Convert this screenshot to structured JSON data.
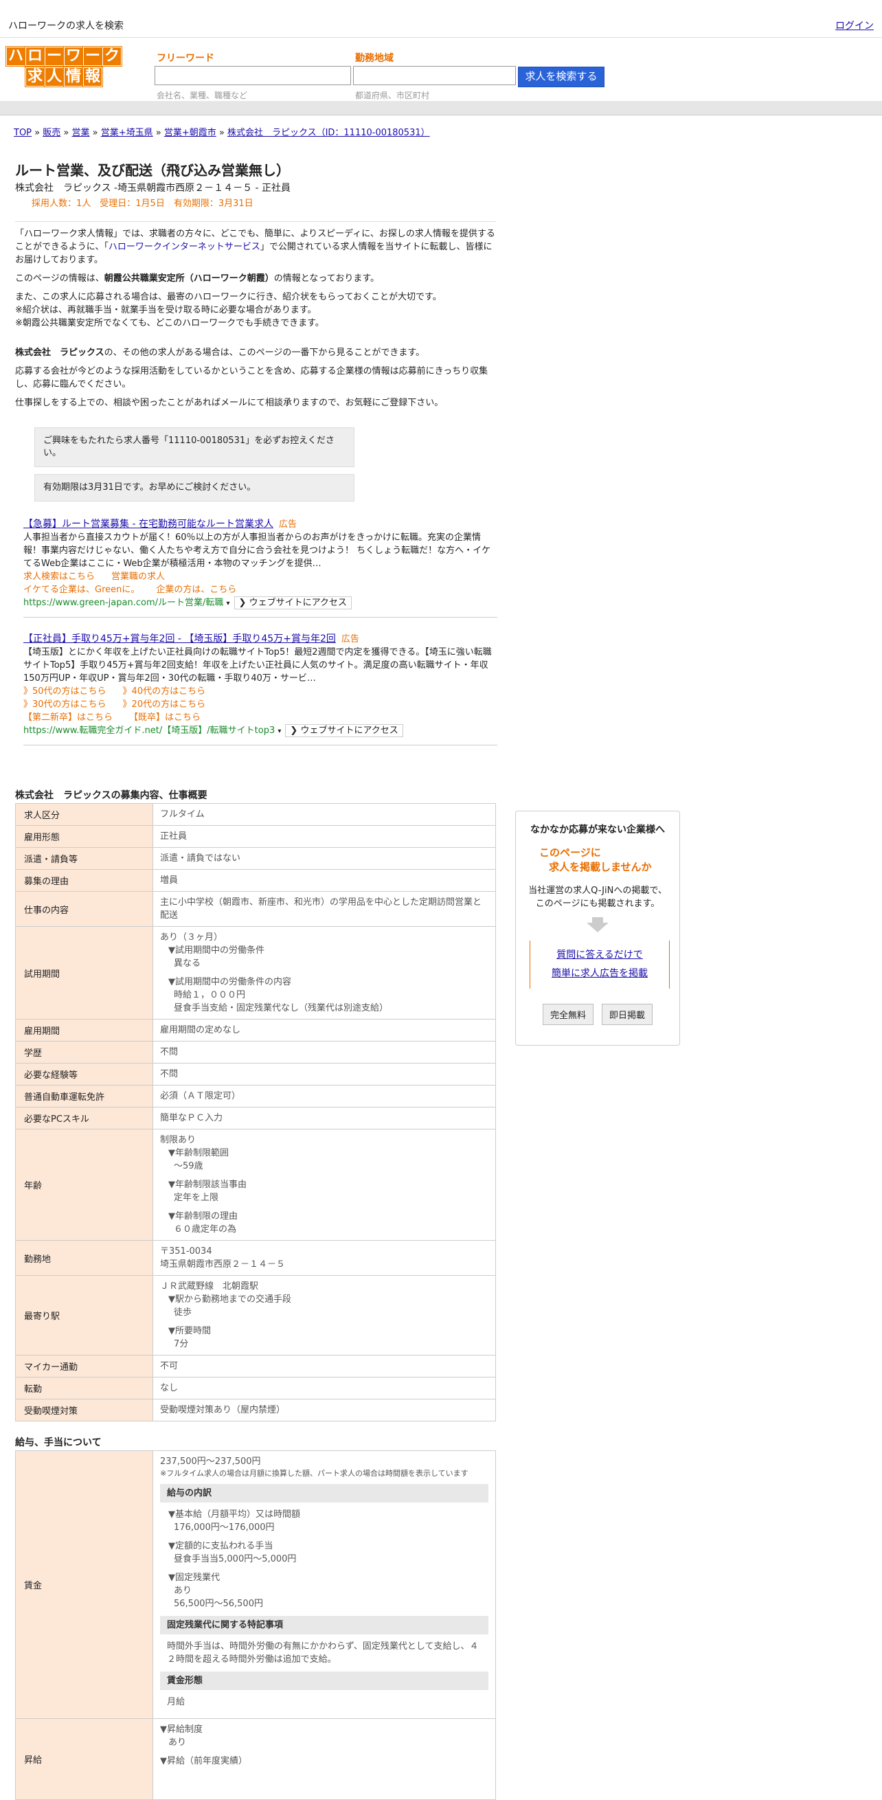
{
  "topbar": {
    "title": "ハローワークの求人を検索",
    "login": "ログイン"
  },
  "logo": {
    "row1": [
      "ハ",
      "ロ",
      "ー",
      "ワ",
      "ー",
      "ク"
    ],
    "row2": [
      "求",
      "人",
      "情",
      "報"
    ]
  },
  "search": {
    "keyword_label": "フリーワード",
    "keyword_hint": "会社名、業種、職種など",
    "area_label": "勤務地域",
    "area_hint": "都道府県、市区町村",
    "button": "求人を検索する"
  },
  "breadcrumb": [
    "TOP",
    "販売",
    "営業",
    "営業+埼玉県",
    "営業+朝霞市",
    "株式会社　ラピックス（ID：11110-00180531）"
  ],
  "job": {
    "title": "ルート営業、及び配送（飛び込み営業無し）",
    "subtitle": "株式会社　ラピックス -埼玉県朝霞市西原２－１４－５ - 正社員",
    "meta": "採用人数：1人　受理日：1月5日　有効期限：3月31日"
  },
  "intro": {
    "p1a": "「ハローワーク求人情報」では、求職者の方々に、どこでも、簡単に、よりスピーディに、お探しの求人情報を提供することができるように、「",
    "p1link": "ハローワークインターネットサービス",
    "p1b": "」で公開されている求人情報を当サイトに転載し、皆様にお届けしております。",
    "p2a": "このページの情報は、",
    "p2b": "朝霞公共職業安定所（ハローワーク朝霞）",
    "p2c": "の情報となっております。",
    "p3": "また、この求人に応募される場合は、最寄のハローワークに行き、紹介状をもらっておくことが大切です。",
    "p4": "※紹介状は、再就職手当・就業手当を受け取る時に必要な場合があります。",
    "p5": "※朝霞公共職業安定所でなくても、どこのハローワークでも手続きできます。",
    "p6a": "株式会社　ラピックス",
    "p6b": "の、その他の求人がある場合は、このページの一番下から見ることができます。",
    "p7": "応募する会社が今どのような採用活動をしているかということを含め、応募する企業様の情報は応募前にきっちり収集し、応募に臨んでください。",
    "p8": "仕事探しをする上での、相談や困ったことがあればメールにて相談承りますので、お気軽にご登録下さい。"
  },
  "notes": [
    "ご興味をもたれたら求人番号「11110-00180531」を必ずお控えください。",
    "有効期限は3月31日です。お早めにご検討ください。"
  ],
  "ads": [
    {
      "title": "【急募】ルート営業募集 - 在宅勤務可能なルート営業求人",
      "badge": "広告",
      "desc": "人事担当者から直接スカウトが届く！60％以上の方が人事担当者からのお声がけをきっかけに転職。充実の企業情報！事業内容だけじゃない、働く人たちや考え方で自分に合う会社を見つけよう！ ちくしょう転職だ！な方へ・イケてるWeb企業はここに・Web企業が積極活用・本物のマッチングを提供…",
      "links1": [
        "求人検索はこちら",
        "営業職の求人"
      ],
      "links2": [
        "イケてる企業は、Greenに。",
        "企業の方は、こちら"
      ],
      "url": "https://www.green-japan.com/ルート営業/転職",
      "visit": "❯ ウェブサイトにアクセス"
    },
    {
      "title": "【正社員】手取り45万+賞与年2回 - 【埼玉版】手取り45万+賞与年2回",
      "badge": "広告",
      "desc": "【埼玉版】とにかく年収を上げたい正社員向けの転職サイトTop5！最短2週間で内定を獲得できる。【埼玉に強い転職サイトTop5】手取り45万+賞与年2回支給！年収を上げたい正社員に人気のサイト。満足度の高い転職サイト・年収150万円UP・年収UP・賞与年2回・30代の転職・手取り40万・サービ…",
      "links1": [
        "》50代の方はこちら",
        "》40代の方はこちら"
      ],
      "links2": [
        "》30代の方はこちら",
        "》20代の方はこちら"
      ],
      "links3": [
        "【第二新卒】はこちら",
        "【既卒】はこちら"
      ],
      "url": "https://www.転職完全ガイド.net/【埼玉版】/転職サイトtop3",
      "visit": "❯ ウェブサイトにアクセス"
    }
  ],
  "outline": {
    "title": "株式会社　ラピックスの募集内容、仕事概要",
    "rows": {
      "kubun": [
        "求人区分",
        "フルタイム"
      ],
      "keitai": [
        "雇用形態",
        "正社員"
      ],
      "haken": [
        "派遣・請負等",
        "派遣・請負ではない"
      ],
      "riyu": [
        "募集の理由",
        "増員"
      ],
      "naiyo": [
        "仕事の内容",
        "主に小中学校（朝霞市、新座市、和光市）の学用品を中心とした定期訪問営業と配送"
      ],
      "shiyo_label": "試用期間",
      "shiyo": {
        "v1": "あり（３ヶ月）",
        "h1": "▼試用期間中の労働条件",
        "v2": "異なる",
        "h2": "▼試用期間中の労働条件の内容",
        "v3": "時給１，０００円",
        "v4": "昼食手当支給・固定残業代なし（残業代は別途支給）"
      },
      "kikan": [
        "雇用期間",
        "雇用期間の定めなし"
      ],
      "gakureki": [
        "学歴",
        "不問"
      ],
      "keiken": [
        "必要な経験等",
        "不問"
      ],
      "menkyo": [
        "普通自動車運転免許",
        "必須（ＡＴ限定可）"
      ],
      "pc": [
        "必要なPCスキル",
        "簡単なＰＣ入力"
      ],
      "nenrei_label": "年齢",
      "nenrei": {
        "v1": "制限あり",
        "h1": "▼年齢制限範囲",
        "v2": "〜59歳",
        "h2": "▼年齢制限該当事由",
        "v3": "定年を上限",
        "h3": "▼年齢制限の理由",
        "v4": "６０歳定年の為"
      },
      "kinmuchi_label": "勤務地",
      "kinmuchi": {
        "zip": "〒351-0034",
        "addr": "埼玉県朝霞市西原２－１４－５"
      },
      "eki_label": "最寄り駅",
      "eki": {
        "v1": "ＪＲ武蔵野線　北朝霞駅",
        "h1": "▼駅から勤務地までの交通手段",
        "v2": "徒歩",
        "h2": "▼所要時間",
        "v3": "7分"
      },
      "mycar": [
        "マイカー通勤",
        "不可"
      ],
      "tenkin": [
        "転勤",
        "なし"
      ],
      "judo": [
        "受動喫煙対策",
        "受動喫煙対策あり（屋内禁煙）"
      ]
    }
  },
  "salary": {
    "title": "給与、手当について",
    "chingin_label": "賃金",
    "range": "237,500円〜237,500円",
    "range_note": "※フルタイム求人の場合は月額に換算した額、パート求人の場合は時間額を表示しています",
    "sub1": "給与の内訳",
    "h1": "▼基本給（月額平均）又は時間額",
    "v1": "176,000円〜176,000円",
    "h2": "▼定額的に支払われる手当",
    "v2": "昼食手当当5,000円〜5,000円",
    "h3": "▼固定残業代",
    "v3a": "あり",
    "v3b": "56,500円〜56,500円",
    "sub2": "固定残業代に関する特記事項",
    "tokki": "時間外手当は、時間外労働の有無にかかわらず、固定残業代として支給し、４２時間を超える時間外労働は追加で支給。",
    "sub3": "賃金形態",
    "keitai": "月給",
    "shokyu_label": "昇給",
    "sh1": "▼昇給制度",
    "sv1": "あり",
    "sh2": "▼昇給（前年度実績）"
  },
  "sidebox": {
    "heading": "なかなか応募が来ない企業様へ",
    "catch1": "このページに",
    "catch2": "求人を掲載しませんか",
    "body1": "当社運営の求人Q-JiNへの掲載で、",
    "body2": "このページにも掲載されます。",
    "cta1": "質問に答えるだけで",
    "cta2": "簡単に求人広告を掲載",
    "btn1": "完全無料",
    "btn2": "即日掲載"
  }
}
